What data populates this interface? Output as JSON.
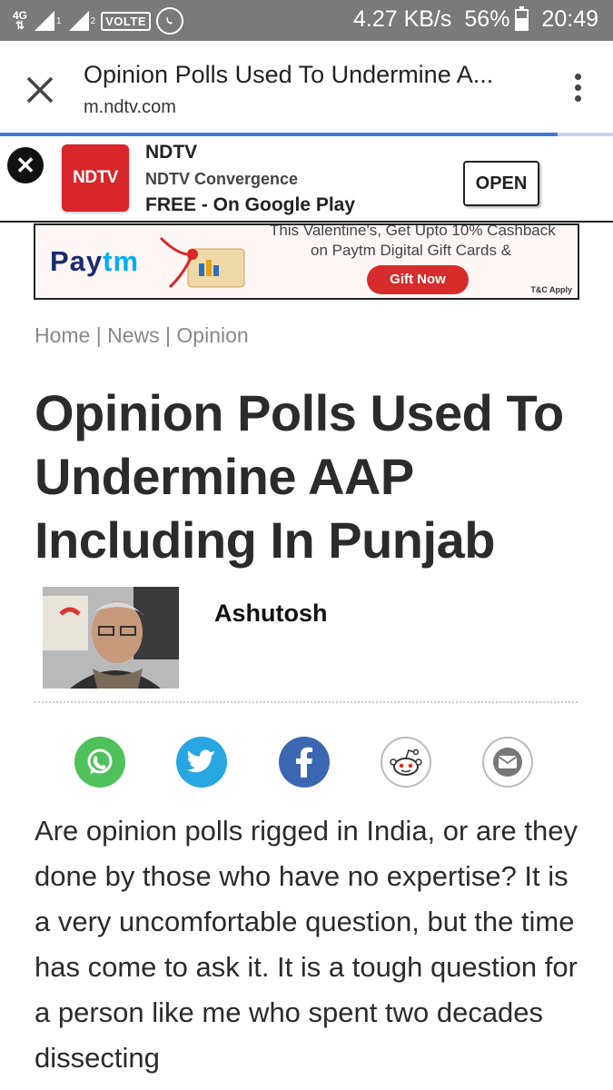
{
  "status_bar": {
    "network": "4G",
    "sim1": "1",
    "sim2": "2",
    "volte": "VOLTE",
    "speed": "4.27 KB/s",
    "battery": "56%",
    "battery_level": 0.56,
    "time": "20:49",
    "icons": [
      "signal-icon",
      "whatsapp-icon",
      "battery-icon"
    ]
  },
  "toolbar": {
    "title": "Opinion Polls Used To Undermine A...",
    "url": "m.ndtv.com",
    "load_progress": 0.91
  },
  "app_banner": {
    "logo_text": "NDTV",
    "app_name": "NDTV",
    "developer": "NDTV Convergence",
    "price_line": "FREE - On Google Play",
    "open_label": "OPEN"
  },
  "ad": {
    "brand": "Paytm",
    "line1": "This Valentine's, Get Upto 10% Cashback",
    "line2": "on Paytm Digital Gift Cards &",
    "cta": "Gift Now",
    "terms": "T&C Apply"
  },
  "breadcrumb": {
    "items": [
      "Home",
      "News",
      "Opinion"
    ],
    "separator": "|"
  },
  "article": {
    "headline": "Opinion Polls Used To Undermine AAP Including In Punjab",
    "author": "Ashutosh",
    "body": "Are opinion polls rigged in India, or are they done by those who have no expertise? It is a very uncomfortable question, but the time has come to ask it. It is a tough question for a person like me who spent two decades dissecting"
  },
  "share": {
    "icons": [
      "whatsapp-icon",
      "twitter-icon",
      "facebook-icon",
      "reddit-icon",
      "email-icon"
    ],
    "colors": {
      "whatsapp": "#4fc15a",
      "twitter": "#27a6e1",
      "facebook": "#3b66b1"
    }
  }
}
